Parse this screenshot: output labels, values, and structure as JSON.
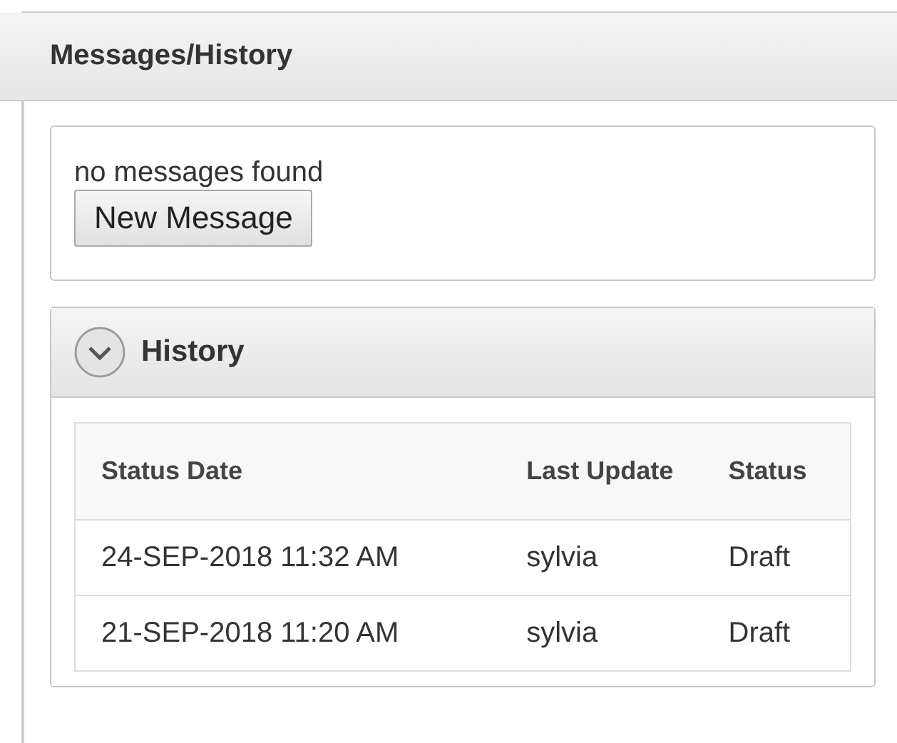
{
  "panel": {
    "title": "Messages/History"
  },
  "messages": {
    "text": "no messages found",
    "button": "New Message"
  },
  "history": {
    "title": "History",
    "expanded": true,
    "columns": [
      "Status Date",
      "Last Update",
      "Status"
    ],
    "rows": [
      [
        "24-SEP-2018 11:32 AM",
        "sylvia",
        "Draft"
      ],
      [
        "21-SEP-2018 11:20 AM",
        "sylvia",
        "Draft"
      ]
    ]
  }
}
